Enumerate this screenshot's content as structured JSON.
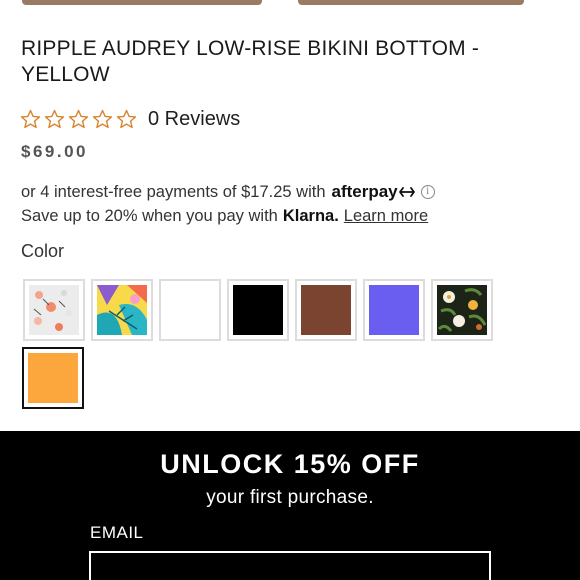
{
  "product": {
    "title": "RIPPLE AUDREY LOW-RISE BIKINI BOTTOM - YELLOW",
    "rating_value": 0,
    "rating_max": 5,
    "reviews_label": "0 Reviews",
    "price": "$69.00"
  },
  "payments": {
    "afterpay_text": "or 4 interest-free payments of $17.25 with",
    "afterpay_brand": "afterpay",
    "afterpay_icon": "afterpay-arrows-icon",
    "info_icon": "info-icon",
    "klarna_text": "Save up to 20% when you pay with",
    "klarna_brand": "Klarna.",
    "learn_more": "Learn more"
  },
  "colors": {
    "label": "Color",
    "swatches": [
      {
        "name": "floral-white",
        "color": "#e9e9e9",
        "pattern": "floral-white",
        "selected": false
      },
      {
        "name": "tropical-print",
        "color": "#2bb6c5",
        "pattern": "tropical",
        "selected": false
      },
      {
        "name": "white",
        "color": "#ffffff",
        "pattern": "solid",
        "selected": false
      },
      {
        "name": "black",
        "color": "#000000",
        "pattern": "solid",
        "selected": false
      },
      {
        "name": "brown",
        "color": "#7a4430",
        "pattern": "solid",
        "selected": false
      },
      {
        "name": "periwinkle",
        "color": "#6a5ef0",
        "pattern": "solid",
        "selected": false
      },
      {
        "name": "dark-floral",
        "color": "#1c2418",
        "pattern": "floral-dark",
        "selected": false
      },
      {
        "name": "yellow",
        "color": "#fca73d",
        "pattern": "solid",
        "selected": true
      }
    ]
  },
  "promo": {
    "title": "UNLOCK 15% OFF",
    "subtitle": "your first purchase.",
    "email_label": "EMAIL",
    "email_value": "",
    "email_placeholder": ""
  },
  "theme": {
    "star_outline": "#d9822b",
    "promo_bg": "#000000",
    "accent_text": "#ffffff"
  }
}
